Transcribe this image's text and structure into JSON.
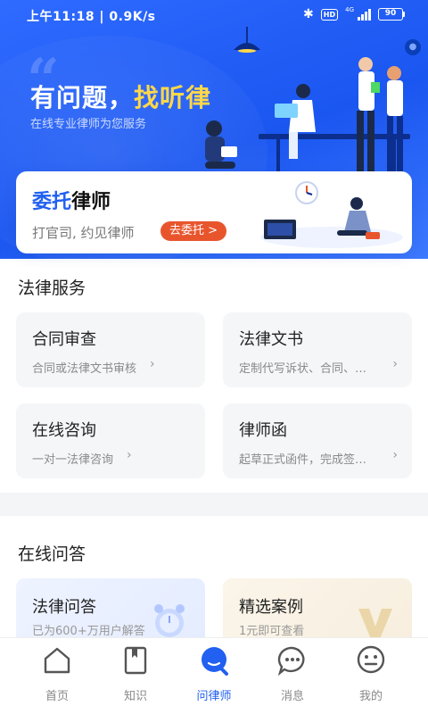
{
  "status_bar": {
    "time": "上午11:18 | 0.9K/s",
    "network": "4G",
    "hd": "HD",
    "battery": "90"
  },
  "hero": {
    "title_prefix": "有问题，",
    "title_accent": "找听律",
    "subtitle": "在线专业律师为您服务"
  },
  "entrust_card": {
    "title_blue": "委托",
    "title_rest": "律师",
    "subtitle": "打官司, 约见律师",
    "button": "去委托 >"
  },
  "legal_services": {
    "title": "法律服务",
    "items": [
      {
        "name": "合同审查",
        "desc": "合同或法律文书审核"
      },
      {
        "name": "法律文书",
        "desc": "定制代写诉状、合同、…"
      },
      {
        "name": "在线咨询",
        "desc": "一对一法律咨询"
      },
      {
        "name": "律师函",
        "desc": "起草正式函件，完成签…"
      }
    ]
  },
  "online_qa": {
    "title": "在线问答",
    "items": [
      {
        "name": "法律问答",
        "desc": "已为600+万用户解答"
      },
      {
        "name": "精选案例",
        "desc": "1元即可查看"
      }
    ]
  },
  "tabbar": {
    "items": [
      {
        "label": "首页",
        "icon": "home-icon"
      },
      {
        "label": "知识",
        "icon": "book-icon"
      },
      {
        "label": "问律师",
        "icon": "ask-lawyer-icon",
        "active": true
      },
      {
        "label": "消息",
        "icon": "message-icon"
      },
      {
        "label": "我的",
        "icon": "profile-icon"
      }
    ]
  },
  "colors": {
    "brand_blue": "#2160f0",
    "accent_yellow": "#ffd84a",
    "cta_orange": "#e8552d"
  }
}
